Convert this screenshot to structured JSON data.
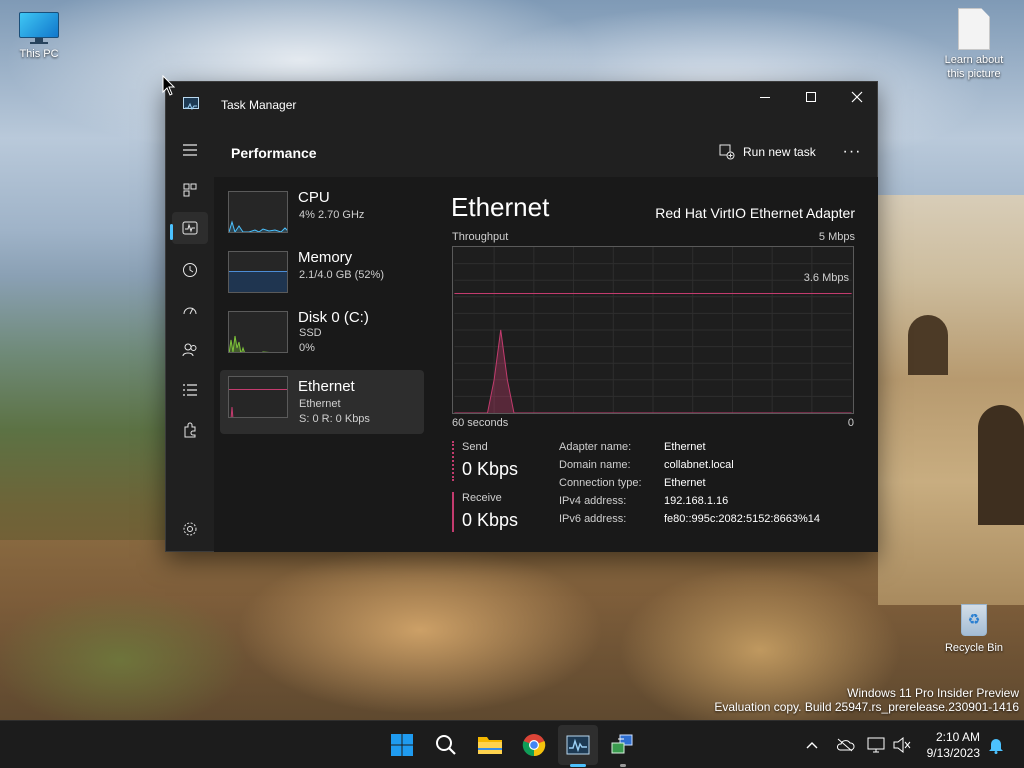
{
  "desktop": {
    "icons": [
      {
        "label": "This PC"
      },
      {
        "label": "Learn about this picture"
      },
      {
        "label": "Recycle Bin"
      }
    ],
    "watermark_line1": "Windows 11 Pro Insider Preview",
    "watermark_line2": "Evaluation copy. Build 25947.rs_prerelease.230901-1416"
  },
  "window": {
    "title": "Task Manager",
    "header_title": "Performance",
    "run_new_task": "Run new task",
    "more": "···"
  },
  "sidebar": {
    "items": [
      {
        "icon": "hamburger-icon"
      },
      {
        "icon": "processes-icon"
      },
      {
        "icon": "performance-icon",
        "active": true
      },
      {
        "icon": "app-history-icon"
      },
      {
        "icon": "startup-apps-icon"
      },
      {
        "icon": "users-icon"
      },
      {
        "icon": "details-icon"
      },
      {
        "icon": "services-icon"
      },
      {
        "icon": "settings-icon"
      }
    ]
  },
  "perf_list": [
    {
      "name": "CPU",
      "sub1": "4%  2.70 GHz",
      "color": "#4cc2ff"
    },
    {
      "name": "Memory",
      "sub1": "2.1/4.0 GB (52%)",
      "color": "#4c8dd6"
    },
    {
      "name": "Disk 0 (C:)",
      "sub1": "SSD",
      "sub2": "0%",
      "color": "#7fc63a"
    },
    {
      "name": "Ethernet",
      "sub1": "Ethernet",
      "sub2": "S: 0  R: 0 Kbps",
      "color": "#c33b6e",
      "selected": true
    }
  ],
  "detail": {
    "title": "Ethernet",
    "adapter": "Red Hat VirtIO Ethernet Adapter",
    "throughput_label": "Throughput",
    "max_label": "5 Mbps",
    "line_label": "3.6 Mbps",
    "x_left": "60 seconds",
    "x_right": "0",
    "send_label": "Send",
    "send_value": "0 Kbps",
    "receive_label": "Receive",
    "receive_value": "0 Kbps",
    "info": [
      {
        "key": "Adapter name:",
        "value": "Ethernet"
      },
      {
        "key": "Domain name:",
        "value": "collabnet.local"
      },
      {
        "key": "Connection type:",
        "value": "Ethernet"
      },
      {
        "key": "IPv4 address:",
        "value": "192.168.1.16"
      },
      {
        "key": "IPv6 address:",
        "value": "fe80::995c:2082:5152:8663%14"
      }
    ]
  },
  "chart_data": {
    "type": "line",
    "title": "Throughput",
    "xlabel": "",
    "ylabel": "",
    "x_range_label": [
      "60 seconds",
      "0"
    ],
    "ylim": [
      0,
      5
    ],
    "y_unit": "Mbps",
    "reference_line": 3.6,
    "series": [
      {
        "name": "Send",
        "values": [
          0,
          0,
          0,
          0,
          0,
          0,
          1.0,
          2.5,
          1.0,
          0,
          0,
          0,
          0,
          0,
          0,
          0,
          0,
          0,
          0,
          0,
          0,
          0,
          0,
          0,
          0,
          0,
          0,
          0,
          0,
          0,
          0,
          0,
          0,
          0,
          0,
          0,
          0,
          0,
          0,
          0,
          0,
          0,
          0,
          0,
          0,
          0,
          0,
          0,
          0,
          0,
          0,
          0,
          0,
          0,
          0,
          0,
          0,
          0,
          0,
          0,
          0
        ]
      }
    ],
    "grid": true
  },
  "taskbar": {
    "time": "2:10 AM",
    "date": "9/13/2023",
    "apps": [
      "start-icon",
      "search-icon",
      "file-explorer-icon",
      "chrome-icon",
      "task-manager-icon",
      "network-app-icon"
    ],
    "tray": [
      "chevron-up-icon",
      "onedrive-icon",
      "display-icon",
      "volume-muted-icon",
      "notification-bell-icon"
    ]
  }
}
